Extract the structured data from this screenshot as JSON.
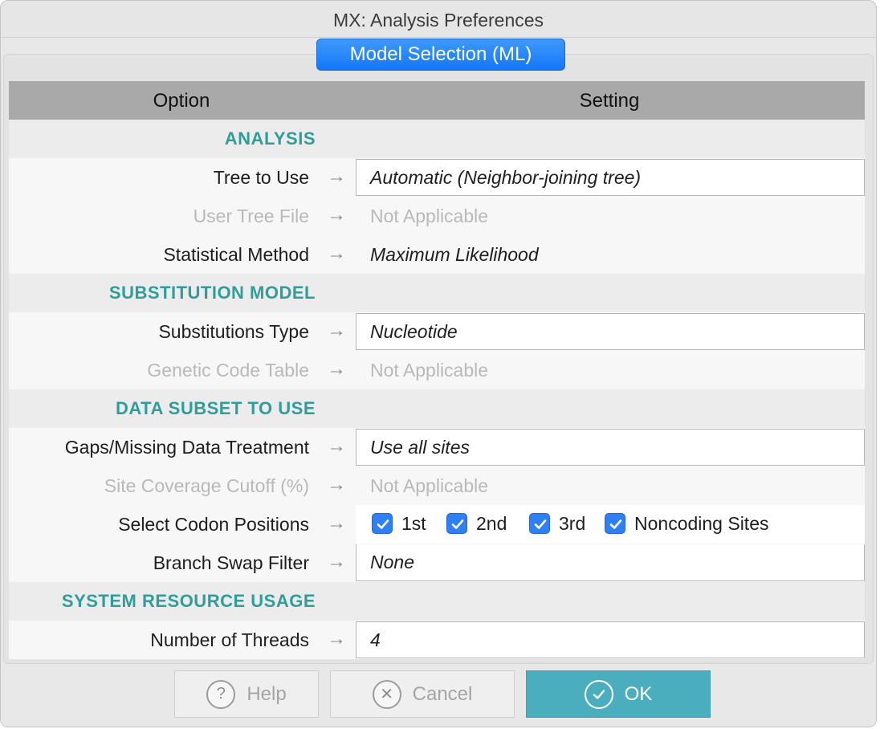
{
  "window": {
    "title": "MX: Analysis Preferences"
  },
  "tab": {
    "label": "Model Selection (ML)"
  },
  "table": {
    "col_option": "Option",
    "col_setting": "Setting"
  },
  "sections": {
    "analysis": "ANALYSIS",
    "substitution": "SUBSTITUTION MODEL",
    "data_subset": "DATA SUBSET TO USE",
    "system": "SYSTEM RESOURCE USAGE"
  },
  "rows": {
    "tree_to_use": {
      "label": "Tree to Use",
      "value": "Automatic (Neighbor-joining tree)"
    },
    "user_tree_file": {
      "label": "User Tree File",
      "value": "Not Applicable"
    },
    "statistical_method": {
      "label": "Statistical Method",
      "value": "Maximum Likelihood"
    },
    "substitutions_type": {
      "label": "Substitutions Type",
      "value": "Nucleotide"
    },
    "genetic_code_table": {
      "label": "Genetic Code Table",
      "value": "Not Applicable"
    },
    "gaps_missing": {
      "label": "Gaps/Missing Data Treatment",
      "value": "Use all sites"
    },
    "site_coverage": {
      "label": "Site Coverage Cutoff (%)",
      "value": "Not Applicable"
    },
    "codon_positions": {
      "label": "Select Codon Positions"
    },
    "branch_swap": {
      "label": "Branch Swap Filter",
      "value": "None"
    },
    "threads": {
      "label": "Number of Threads",
      "value": "4"
    }
  },
  "codons": [
    {
      "label": "1st",
      "checked": true
    },
    {
      "label": "2nd",
      "checked": true
    },
    {
      "label": "3rd",
      "checked": true
    },
    {
      "label": "Noncoding Sites",
      "checked": true
    }
  ],
  "arrow_glyph": "→",
  "buttons": {
    "help": "Help",
    "cancel": "Cancel",
    "ok": "OK"
  },
  "icons": {
    "help": "question-circle-icon",
    "cancel": "x-circle-icon",
    "ok": "check-circle-icon"
  },
  "colors": {
    "accent": "#1477f8",
    "section": "#2f9e9a",
    "ok_button": "#4aaebf"
  }
}
